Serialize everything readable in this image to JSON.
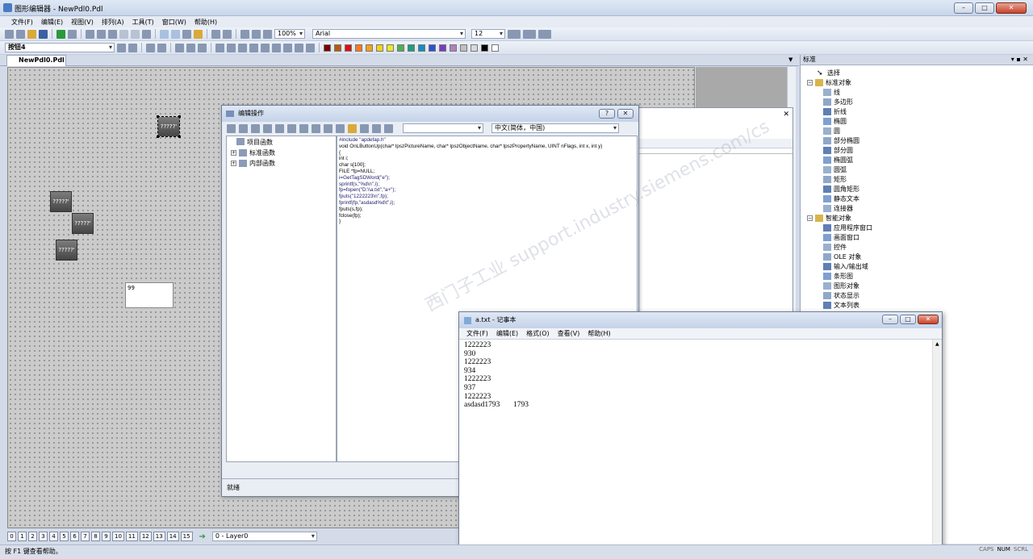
{
  "app": {
    "title": "图形编辑器 - NewPdl0.Pdl"
  },
  "menubar": [
    "文件(F)",
    "编辑(E)",
    "视图(V)",
    "排列(A)",
    "工具(T)",
    "窗口(W)",
    "帮助(H)"
  ],
  "toolbar": {
    "zoom": "100%",
    "font": "Arial",
    "size": "12",
    "object_name": "按钮4"
  },
  "palette": [
    "#7a0000",
    "#b55e00",
    "#e01010",
    "#ff7a1a",
    "#f4a21a",
    "#f6d21a",
    "#eaea2a",
    "#4fb04f",
    "#1aa07a",
    "#1a8ac0",
    "#3050d0",
    "#7a3ac0",
    "#b080c0",
    "#c0c0c0",
    "#d8d8d8",
    "#000000",
    "#ffffff"
  ],
  "doc_tab": {
    "label": "NewPdl0.Pdl"
  },
  "canvas": {
    "io_fields": [
      "?????'",
      "?????'",
      "?????'",
      "?????'"
    ],
    "textbox": "99"
  },
  "layerbar": {
    "pages": [
      "0",
      "1",
      "2",
      "3",
      "4",
      "5",
      "6",
      "7",
      "8",
      "9",
      "10",
      "11",
      "12",
      "13",
      "14",
      "15"
    ],
    "layer": "0 - Layer0"
  },
  "statusbar": {
    "help": "按 F1 键查看帮助。",
    "indicators": [
      "CAPS",
      "NUM",
      "SCRL"
    ]
  },
  "right_panel": {
    "title": "标准",
    "items": [
      {
        "label": "选择",
        "level": 1
      },
      {
        "label": "标准对象",
        "level": 0
      },
      {
        "label": "线",
        "level": 2
      },
      {
        "label": "多边形",
        "level": 2
      },
      {
        "label": "折线",
        "level": 2
      },
      {
        "label": "椭圆",
        "level": 2
      },
      {
        "label": "圆",
        "level": 2
      },
      {
        "label": "部分椭圆",
        "level": 2
      },
      {
        "label": "部分圆",
        "level": 2
      },
      {
        "label": "椭圆弧",
        "level": 2
      },
      {
        "label": "圆弧",
        "level": 2
      },
      {
        "label": "矩形",
        "level": 2
      },
      {
        "label": "圆角矩形",
        "level": 2
      },
      {
        "label": "静态文本",
        "level": 2
      },
      {
        "label": "连接器",
        "level": 2
      },
      {
        "label": "智能对象",
        "level": 0
      },
      {
        "label": "应用程序窗口",
        "level": 2
      },
      {
        "label": "画面窗口",
        "level": 2
      },
      {
        "label": "控件",
        "level": 2
      },
      {
        "label": "OLE 对象",
        "level": 2
      },
      {
        "label": "输入/输出域",
        "level": 2
      },
      {
        "label": "条形图",
        "level": 2
      },
      {
        "label": "图形对象",
        "level": 2
      },
      {
        "label": "状态显示",
        "level": 2
      },
      {
        "label": "文本列表",
        "level": 2
      }
    ]
  },
  "edit_dialog": {
    "title": "编辑操作",
    "language": "中文(简体，中国)",
    "status": "就绪",
    "tree": [
      "项目函数",
      "标准函数",
      "内部函数"
    ],
    "code": [
      "#include \"apdefap.h\"",
      "void OnLButtonUp(char* lpszPictureName, char* lpszObjectName, char* lpszPropertyName, UINT nFlags, int x, int y)",
      "{",
      "int i;",
      "char s[100];",
      "FILE *fp=NULL;",
      "i=GetTagSDWord(\"e\");",
      "sprintf(s,\"%d\\n\",i);",
      "fp=fopen(\"D:\\\\a.txt\",\"a+\");",
      "fputs(\"1222223\\n\",fp);",
      "fprintf(fp,\"asdasd%d\\t\",i);",
      "fputs(s,fp);",
      "fclose(fp);",
      "",
      "}"
    ]
  },
  "notepad": {
    "title": "a.txt - 记事本",
    "menu": [
      "文件(F)",
      "编辑(E)",
      "格式(O)",
      "查看(V)",
      "帮助(H)"
    ],
    "lines": [
      "1222223",
      "930",
      "1222223",
      "934",
      "1222223",
      "937",
      "1222223",
      "asdasd1793       1793"
    ]
  },
  "watermark": "西门子工业 support.industry.siemens.com/cs"
}
